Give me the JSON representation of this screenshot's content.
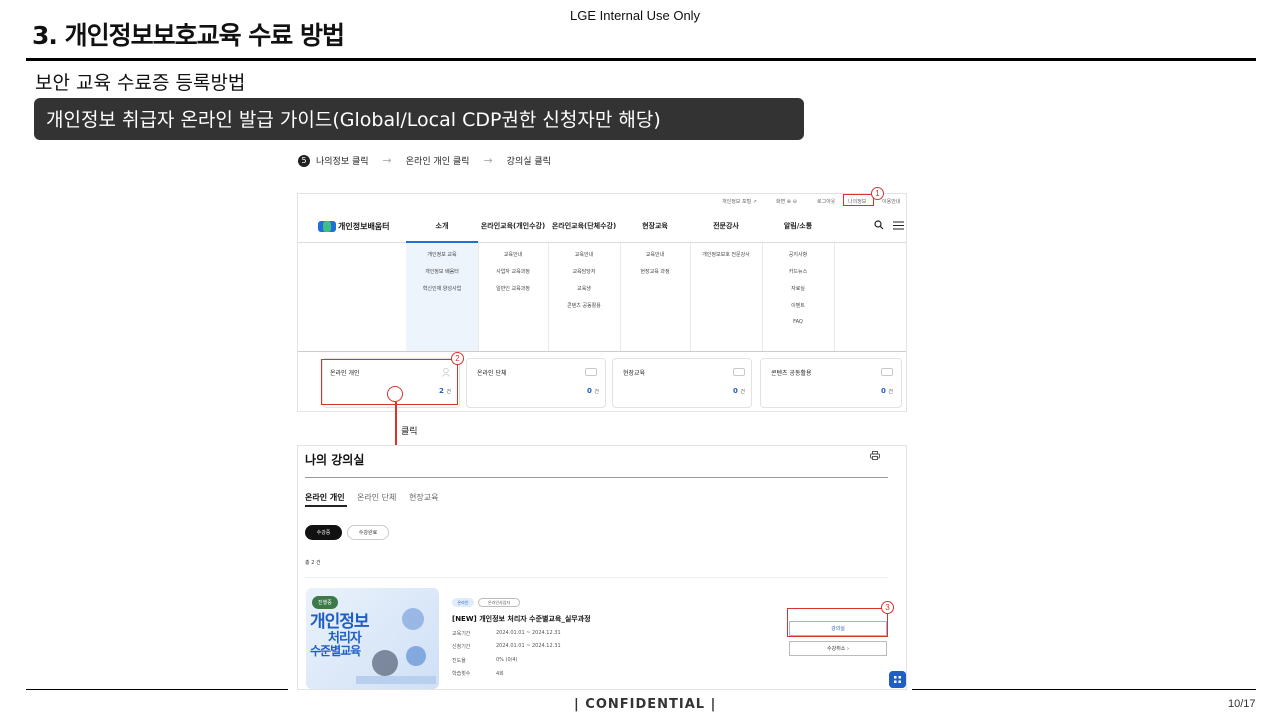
{
  "slide": {
    "title": "3. 개인정보보호교육 수료 방법",
    "internal_label": "LGE Internal Use Only",
    "subtitle": "보안 교육 수료증 등록방법",
    "guide_bar": "개인정보 취급자 온라인 발급 가이드(Global/Local CDP권한 신청자만 해당)",
    "confidential": "| CONFIDENTIAL |",
    "page": "10/17"
  },
  "steps": {
    "number": "5",
    "items": [
      "나의정보 클릭",
      "온라인 개인 클릭",
      "강의실 클릭"
    ],
    "arrow": "→"
  },
  "site": {
    "util_links": [
      "개인정보 포털 ↗",
      "화면 ⊕ ⊖",
      "로그아웃",
      "나의정보",
      "이용안내"
    ],
    "logo": "개인정보배움터",
    "nav": [
      "소개",
      "온라인교육(개인수강)",
      "온라인교육(단체수강)",
      "현장교육",
      "전문강사",
      "알림/소통"
    ],
    "submenu": [
      [
        "개인정보 교육",
        "개인정보 배움터",
        "혁신인재 양성사업"
      ],
      [
        "교육안내",
        "사업자 교육과정",
        "일반인 교육과정"
      ],
      [
        "교육안내",
        "교육담당자",
        "교육생",
        "콘텐츠 공동활용"
      ],
      [
        "교육안내",
        "현장교육 과정"
      ],
      [
        "개인정보보호 전문강사"
      ],
      [
        "공지사항",
        "카드뉴스",
        "자료실",
        "이벤트",
        "FAQ"
      ]
    ],
    "dashboard": [
      {
        "label": "온라인 개인",
        "count": "2",
        "unit": "건"
      },
      {
        "label": "온라인 단체",
        "count": "0",
        "unit": "건"
      },
      {
        "label": "현장교육",
        "count": "0",
        "unit": "건"
      },
      {
        "label": "콘텐츠 공동활용",
        "count": "0",
        "unit": "건"
      }
    ]
  },
  "callouts": {
    "badge1": "1",
    "badge2": "2",
    "badge3": "3",
    "click_label": "클릭"
  },
  "classroom": {
    "title": "나의 강의실",
    "tabs": [
      "온라인 개인",
      "온라인 단체",
      "현장교육"
    ],
    "filters": [
      "수강중",
      "수강완료"
    ],
    "total": "총 2 건",
    "course": {
      "status": "진행중",
      "thumb_lines": [
        "개인정보",
        "처리자",
        "수준별교육"
      ],
      "tags": [
        "온라인",
        "온라인사업자"
      ],
      "title": "[NEW] 개인정보 처리자 수준별교육_실무과정",
      "meta": [
        {
          "key": "교육기간",
          "value": "2024.01.01 ~ 2024.12.31"
        },
        {
          "key": "신청기간",
          "value": "2024.01.01 ~ 2024.12.31"
        },
        {
          "key": "진도율",
          "value": "0% (0/4)"
        },
        {
          "key": "학습횟수",
          "value": "4회"
        }
      ],
      "classroom_button": "강의실",
      "cancel_button": "수강취소 ›"
    }
  }
}
